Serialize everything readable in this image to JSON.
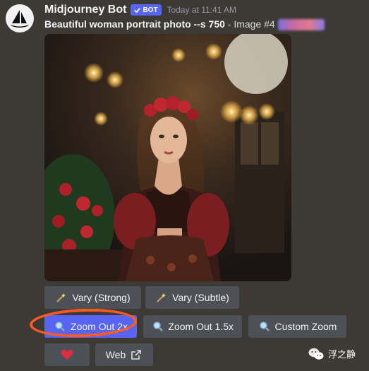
{
  "message": {
    "username": "Midjourney Bot",
    "bot_badge": "BOT",
    "timestamp": "Today at 11:41 AM",
    "prompt_bold": "Beautiful woman portrait photo --s 750",
    "prompt_rest": " - Image #4"
  },
  "buttons": {
    "vary_strong": "Vary (Strong)",
    "vary_subtle": "Vary (Subtle)",
    "zoom_out_2x": "Zoom Out 2x",
    "zoom_out_15x": "Zoom Out 1.5x",
    "custom_zoom": "Custom Zoom",
    "web": "Web"
  },
  "watermark": {
    "text": "浮之静"
  },
  "colors": {
    "background": "#3d3a36",
    "primary": "#5865f2",
    "secondary": "#4e5058",
    "highlight": "#ff5a1f",
    "heart": "#dd2e44"
  },
  "icons": [
    "sailboat-logo-icon",
    "check-icon",
    "magic-wand-icon",
    "magnifier-icon",
    "heart-icon",
    "external-link-icon",
    "wechat-icon"
  ]
}
